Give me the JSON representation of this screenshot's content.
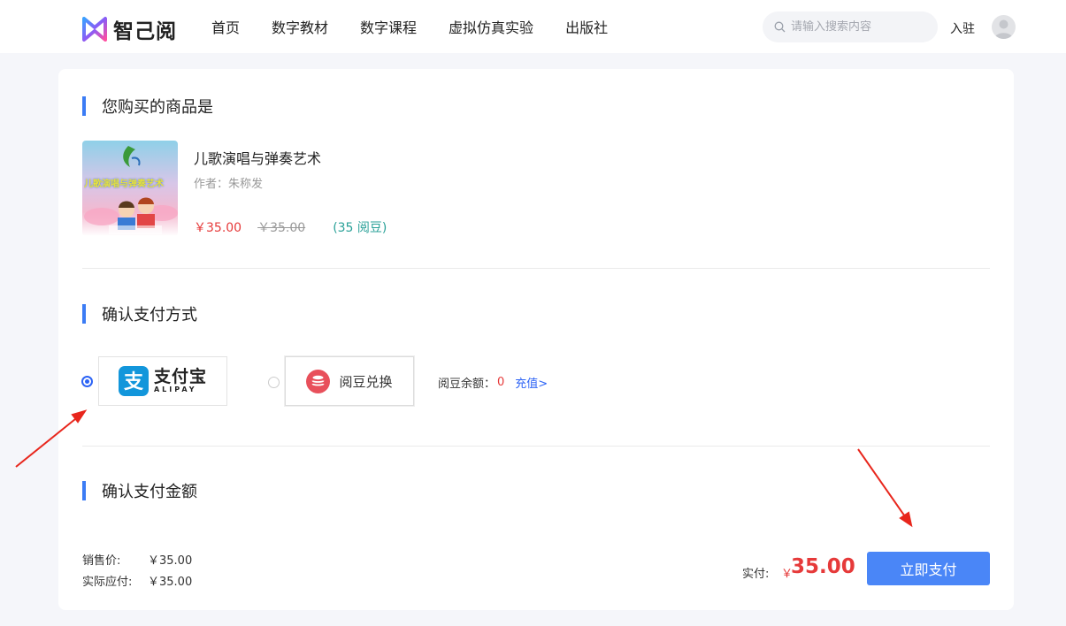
{
  "header": {
    "logo_text": "智己阅",
    "nav": [
      "首页",
      "数字教材",
      "数字课程",
      "虚拟仿真实验",
      "出版社"
    ],
    "search_placeholder": "请输入搜索内容",
    "join_label": "入驻"
  },
  "product_section": {
    "title": "您购买的商品是",
    "product": {
      "cover_text": "儿歌演唱与弹奏艺术",
      "name": "儿歌演唱与弹奏艺术",
      "author": "作者：朱称发",
      "price": "￥35.00",
      "original_price": "￥35.00",
      "beans": "(35 阅豆)"
    }
  },
  "payment_section": {
    "title": "确认支付方式",
    "methods": [
      {
        "name_cn": "支付宝",
        "name_en": "ALIPAY",
        "selected": true
      },
      {
        "name_cn": "阅豆兑换",
        "selected": false
      }
    ],
    "balance_label": "阅豆余额：",
    "balance_value": "0",
    "recharge_label": "充值>"
  },
  "amount_section": {
    "title": "确认支付金额",
    "sale_price_label": "销售价:",
    "sale_price": "￥35.00",
    "actual_label": "实际应付:",
    "actual": "￥35.00",
    "real_pay_label": "实付:",
    "real_pay_currency": "￥",
    "real_pay_value": "35.00",
    "pay_button": "立即支付"
  },
  "colors": {
    "accent": "#3b7cf5",
    "price_red": "#e63a3a",
    "beans_teal": "#2aa198",
    "alipay_blue": "#1296db",
    "arrow_red": "#e8261c"
  }
}
